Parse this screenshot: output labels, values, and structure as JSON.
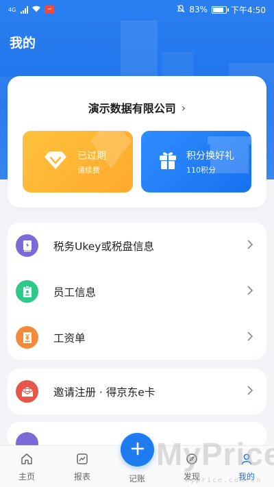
{
  "status_bar": {
    "network": "4G",
    "battery": "83%",
    "time": "下午4:50"
  },
  "page_title": "我的",
  "company": {
    "name": "演示数据有限公司",
    "chevron": "›"
  },
  "promos": [
    {
      "title": "已过期",
      "subtitle": "请续费",
      "icon": "diamond-icon",
      "color": "#ffb332"
    },
    {
      "title": "积分换好礼",
      "subtitle": "110积分",
      "icon": "gift-icon",
      "color": "#1f7cf0"
    }
  ],
  "menu_group_1": [
    {
      "label": "税务Ukey或税盘信息",
      "icon": "tax-device-icon",
      "color": "#7b6ad8"
    },
    {
      "label": "员工信息",
      "icon": "employee-badge-icon",
      "color": "#2dc98a"
    },
    {
      "label": "工资单",
      "icon": "payroll-icon",
      "color": "#f5893a"
    }
  ],
  "menu_group_2": [
    {
      "label": "邀请注册 · 得京东e卡",
      "icon": "invite-envelope-icon",
      "color": "#e8554a"
    }
  ],
  "bottom_nav": [
    {
      "label": "主页",
      "icon": "home-icon"
    },
    {
      "label": "报表",
      "icon": "report-icon"
    },
    {
      "label": "记账",
      "icon": "add-icon"
    },
    {
      "label": "发现",
      "icon": "discover-icon"
    },
    {
      "label": "我的",
      "icon": "user-icon"
    }
  ],
  "active_tab": "我的",
  "watermark": {
    "brand": "MyPrice",
    "domain": "myprice.com.cn"
  }
}
